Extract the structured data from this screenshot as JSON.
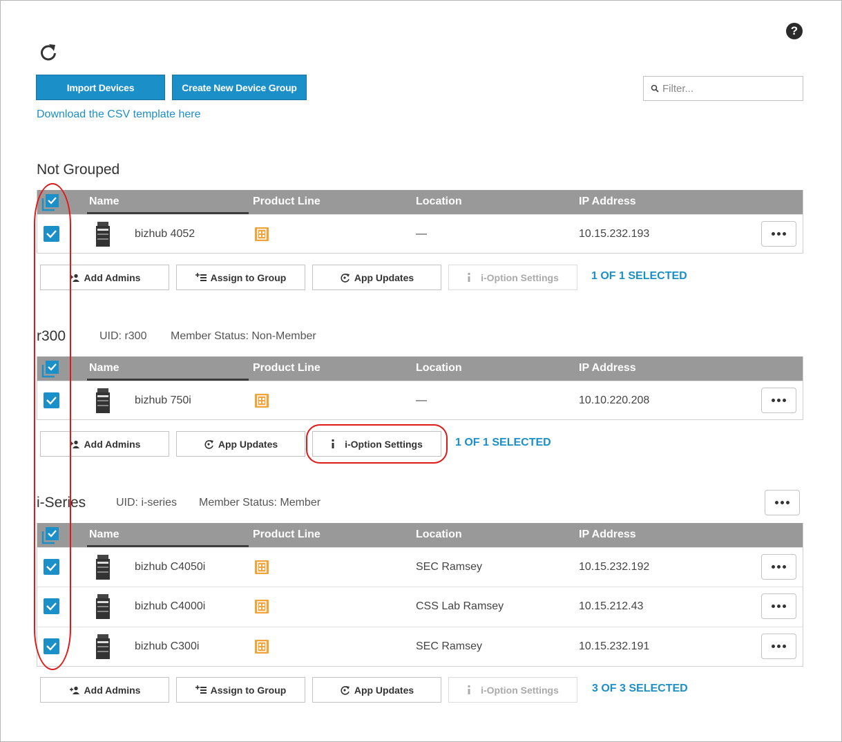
{
  "toolbar": {
    "import_label": "Import Devices",
    "create_group_label": "Create New Device Group",
    "filter_placeholder": "Filter...",
    "csv_link": "Download the CSV template here"
  },
  "columns": {
    "name": "Name",
    "product_line": "Product Line",
    "location": "Location",
    "ip": "IP Address"
  },
  "actions": {
    "add_admins": "Add Admins",
    "assign_group": "Assign to Group",
    "app_updates": "App Updates",
    "ioption": "i-Option Settings"
  },
  "groups": [
    {
      "title": "Not Grouped",
      "rows": [
        {
          "name": "bizhub 4052",
          "location": "—",
          "ip": "10.15.232.193",
          "checked": true
        }
      ],
      "selected": "1 OF 1 SELECTED"
    },
    {
      "title": "r300",
      "uid": "UID: r300",
      "status": "Member Status: Non-Member",
      "rows": [
        {
          "name": "bizhub 750i",
          "location": "—",
          "ip": "10.10.220.208",
          "checked": true
        }
      ],
      "selected": "1 OF 1 SELECTED"
    },
    {
      "title": "i-Series",
      "uid": "UID: i-series",
      "status": "Member Status: Member",
      "rows": [
        {
          "name": "bizhub C4050i",
          "location": "SEC Ramsey",
          "ip": "10.15.232.192",
          "checked": true
        },
        {
          "name": "bizhub C4000i",
          "location": "CSS Lab Ramsey",
          "ip": "10.15.212.43",
          "checked": true
        },
        {
          "name": "bizhub C300i",
          "location": "SEC Ramsey",
          "ip": "10.15.232.191",
          "checked": true
        }
      ],
      "selected": "3 OF 3 SELECTED"
    }
  ],
  "colors": {
    "accent": "#1b8fc7",
    "header_bg": "#999999",
    "product_icon": "#f2a33a",
    "annotation": "#e01818"
  },
  "icons": [
    "refresh-icon",
    "help-icon",
    "search-icon",
    "printer-icon",
    "product-line-icon",
    "add-admin-icon",
    "assign-group-icon",
    "app-updates-icon",
    "info-icon",
    "more-icon"
  ]
}
